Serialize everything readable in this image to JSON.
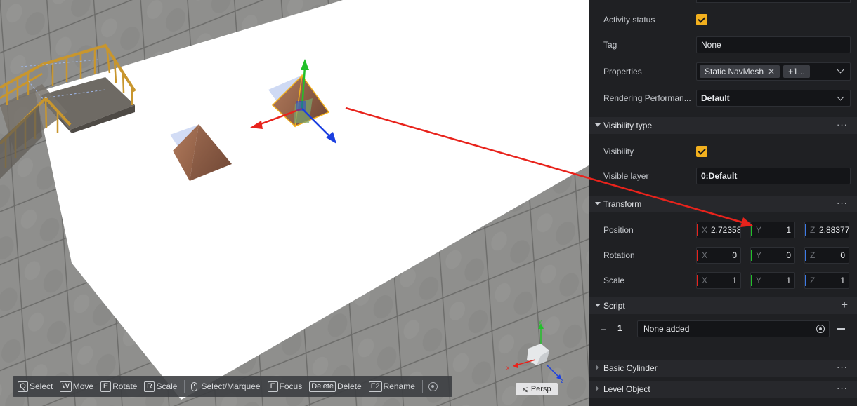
{
  "toolbar": {
    "items": [
      {
        "key": "Q",
        "label": "Select"
      },
      {
        "key": "W",
        "label": "Move"
      },
      {
        "key": "E",
        "label": "Rotate"
      },
      {
        "key": "R",
        "label": "Scale"
      }
    ],
    "marquee_label": "Select/Marquee",
    "focus": {
      "key": "F",
      "label": "Focus"
    },
    "delete": {
      "key": "Delete",
      "label": "Delete"
    },
    "rename": {
      "key": "F2",
      "label": "Rename"
    }
  },
  "viewport": {
    "camera_mode": "Persp",
    "gizmo_axes": {
      "y": "y",
      "x": "x",
      "z": "z"
    },
    "colors": {
      "axis_x": "#e8231c",
      "axis_y": "#22c02a",
      "axis_z": "#1b3fe0",
      "annotation_arrow": "#e8231c"
    }
  },
  "inspector": {
    "activity_status": {
      "label": "Activity status",
      "checked": true
    },
    "tag": {
      "label": "Tag",
      "value": "None"
    },
    "properties": {
      "label": "Properties",
      "chip": "Static NavMesh",
      "more": "+1..."
    },
    "rendering": {
      "label": "Rendering Performan...",
      "value": "Default"
    },
    "visibility_section": {
      "title": "Visibility type",
      "visibility": {
        "label": "Visibility",
        "checked": true
      },
      "visible_layer": {
        "label": "Visible layer",
        "value": "0:Default"
      }
    },
    "transform": {
      "title": "Transform",
      "position": {
        "label": "Position",
        "x": "2.72358",
        "y": "1",
        "z": "2.88377"
      },
      "rotation": {
        "label": "Rotation",
        "x": "0",
        "y": "0",
        "z": "0"
      },
      "scale": {
        "label": "Scale",
        "x": "1",
        "y": "1",
        "z": "1"
      },
      "axis_labels": {
        "x": "X",
        "y": "Y",
        "z": "Z"
      }
    },
    "script": {
      "title": "Script",
      "index": "1",
      "value": "None added"
    },
    "collapsed": [
      {
        "title": "Basic Cylinder"
      },
      {
        "title": "Level Object"
      }
    ],
    "colors": {
      "accent_checkbox": "#f2b01e"
    }
  }
}
